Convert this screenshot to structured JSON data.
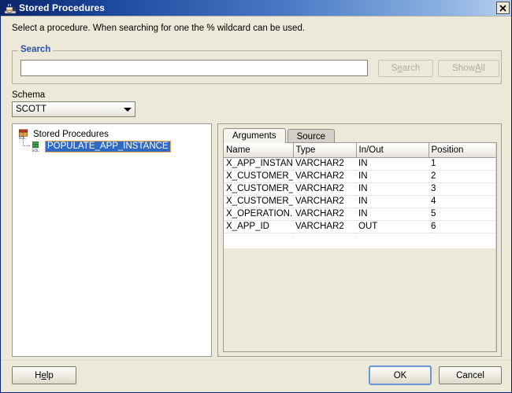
{
  "window": {
    "title": "Stored Procedures",
    "icon": "java-coffee-cup-icon",
    "close_label": "✕",
    "accent_title_start": "#0a246a",
    "accent_title_end": "#b9d0ef",
    "dialog_bg": "#ece9d8"
  },
  "instruction": "Select a procedure. When searching for one the % wildcard can be used.",
  "search": {
    "legend": "Search",
    "legend_color": "#2b51a8",
    "input_value": "",
    "input_placeholder": "",
    "search_button": {
      "pre": "S",
      "mnemonic": "e",
      "post": "arch",
      "label": "Search",
      "enabled": false
    },
    "show_all_button": {
      "pre": "Show ",
      "mnemonic": "A",
      "post": "ll",
      "label": "Show All",
      "enabled": false
    }
  },
  "schema": {
    "label": "Schema",
    "selected": "SCOTT",
    "options": [
      "SCOTT"
    ]
  },
  "tree": {
    "root": {
      "label": "Stored Procedures",
      "icon": "package-sql-icon"
    },
    "child": {
      "label": "POPULATE_APP_INSTANCE",
      "icon": "procedure-sql-icon",
      "selected": true
    },
    "selection_bg": "#316ac5",
    "selection_border": "#e8a33d"
  },
  "tabs": [
    {
      "label": "Arguments",
      "active": true
    },
    {
      "label": "Source",
      "active": false
    }
  ],
  "table": {
    "columns": [
      "Name",
      "Type",
      "In/Out",
      "Position"
    ],
    "rows": [
      [
        "X_APP_INSTAN...",
        "VARCHAR2",
        "IN",
        "1"
      ],
      [
        "X_CUSTOMER_ID",
        "VARCHAR2",
        "IN",
        "2"
      ],
      [
        "X_CUSTOMER_...",
        "VARCHAR2",
        "IN",
        "3"
      ],
      [
        "X_CUSTOMER_...",
        "VARCHAR2",
        "IN",
        "4"
      ],
      [
        "X_OPERATION...",
        "VARCHAR2",
        "IN",
        "5"
      ],
      [
        "X_APP_ID",
        "VARCHAR2",
        "OUT",
        "6"
      ]
    ]
  },
  "footer": {
    "help": {
      "pre": "H",
      "mnemonic": "e",
      "post": "lp",
      "label": "Help"
    },
    "ok": "OK",
    "cancel": "Cancel"
  }
}
